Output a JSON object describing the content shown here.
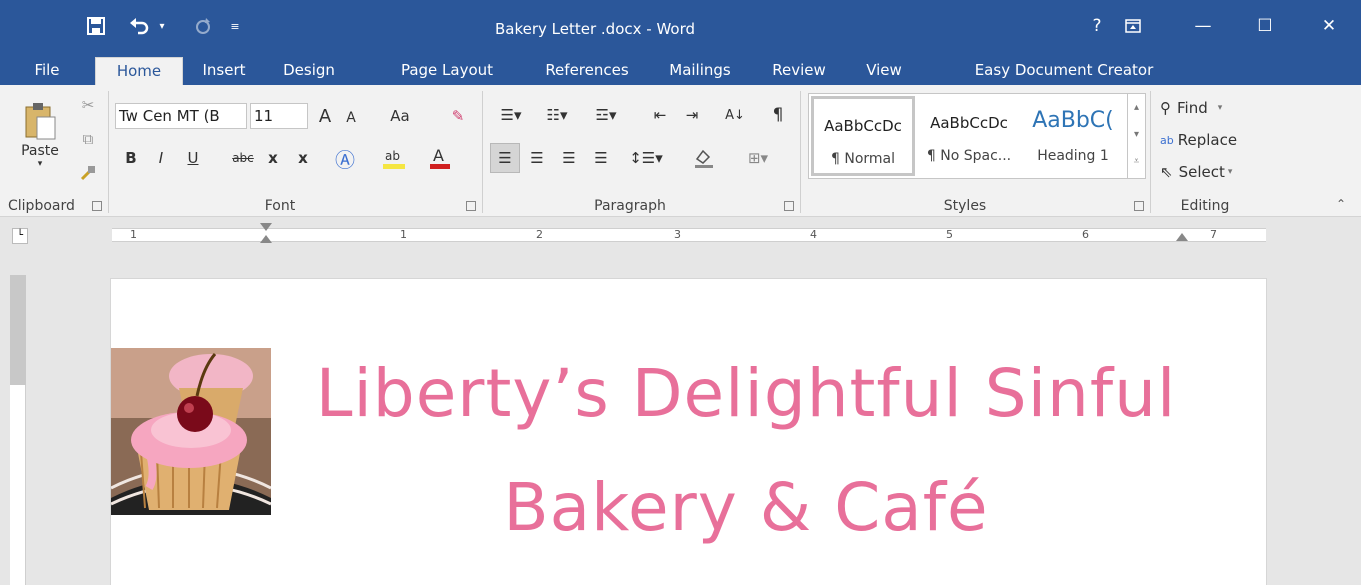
{
  "window": {
    "title": "Bakery Letter .docx  - Word",
    "help": "?",
    "ribbon_display_icon": "ribbon-display-icon",
    "minimize": "—",
    "maximize": "☐",
    "close": "✕"
  },
  "quick_access": {
    "save_icon": "save-icon",
    "undo_icon": "undo-icon",
    "redo_icon": "redo-icon"
  },
  "tabs": [
    "File",
    "Home",
    "Insert",
    "Design",
    "Page Layout",
    "References",
    "Mailings",
    "Review",
    "View",
    "Easy Document Creator"
  ],
  "active_tab": "Home",
  "clipboard": {
    "paste_label": "Paste",
    "group_label": "Clipboard"
  },
  "font": {
    "font_name": "Tw Cen MT (B",
    "font_size": "11",
    "grow": "A",
    "shrink": "A",
    "change_case": "Aa",
    "bold": "B",
    "italic": "I",
    "underline": "U",
    "strikethrough": "abc",
    "subscript": "x",
    "superscript": "x",
    "group_label": "Font"
  },
  "paragraph": {
    "sort": "A↓",
    "show_marks": "¶",
    "group_label": "Paragraph"
  },
  "styles": {
    "tiles": [
      {
        "sample": "AaBbCcDc",
        "name": "¶ Normal"
      },
      {
        "sample": "AaBbCcDc",
        "name": "¶ No Spac..."
      },
      {
        "sample": "AaBbC(",
        "name": "Heading 1"
      }
    ],
    "group_label": "Styles"
  },
  "editing": {
    "find": "Find",
    "replace": "Replace",
    "select": "Select",
    "group_label": "Editing"
  },
  "ruler": {
    "marks": [
      "1",
      "1",
      "2",
      "3",
      "4",
      "5",
      "6",
      "7"
    ]
  },
  "document": {
    "heading_line1": "Liberty’s Delightful Sinful",
    "heading_line2": "Bakery & Café",
    "heading_color": "#e8709a"
  },
  "colors": {
    "title_bar": "#2b579a",
    "ribbon": "#f2f2f2",
    "highlight_yellow": "#f5e642",
    "font_color_red": "#d02020"
  }
}
